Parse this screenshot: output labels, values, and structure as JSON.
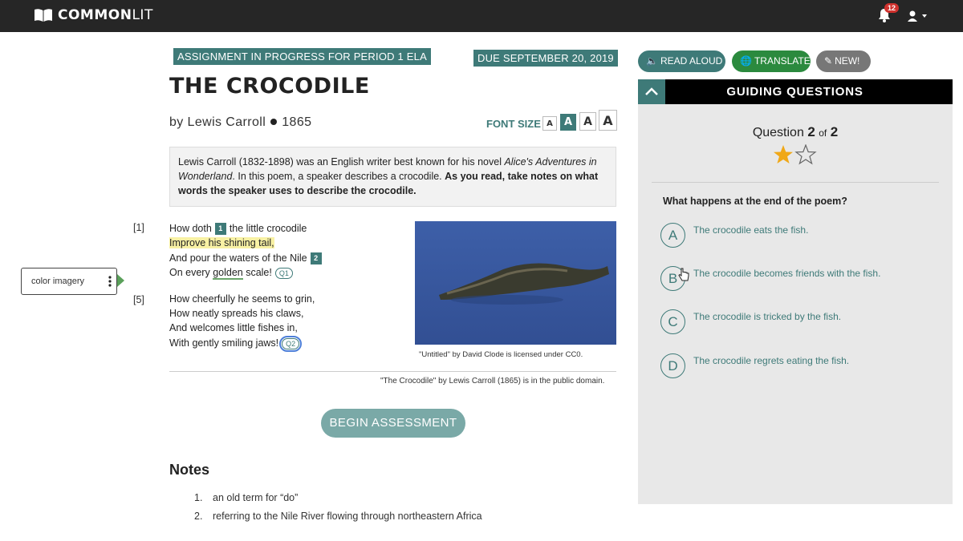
{
  "app": {
    "logo_text_bold": "COMMON",
    "logo_text_thin": "LIT",
    "notification_count": "12"
  },
  "assignment": {
    "tag": "ASSIGNMENT IN PROGRESS FOR PERIOD 1 ELA",
    "due": "DUE SEPTEMBER 20, 2019"
  },
  "text": {
    "title": "THE CROCODILE",
    "author": "by Lewis Carroll",
    "year": "1865",
    "font_size_label": "FONT SIZE",
    "font_size_buttons": [
      "A",
      "A",
      "A",
      "A"
    ],
    "intro_part1": "Lewis Carroll (1832-1898) was an English writer best known for his novel ",
    "intro_italic": "Alice's Adventures in Wonderland",
    "intro_part2": ". In this poem, a speaker describes a crocodile. ",
    "intro_bold": "As you read, take notes on what words the speaker uses to describe the crocodile."
  },
  "poem": {
    "line_numbers": [
      "[1]",
      "[5]"
    ],
    "l1_a": "How doth",
    "l1_fn": "1",
    "l1_b": "the little crocodile",
    "l2": "Improve his shining tail,",
    "l3_a": "And pour the waters of the Nile",
    "l3_fn": "2",
    "l4_a": "On every ",
    "l4_ul": "golden",
    "l4_b": " scale!",
    "l4_q": "Q1",
    "l5": "How cheerfully he seems to grin,",
    "l6": "How neatly spreads his claws,",
    "l7": "And welcomes little fishes in,",
    "l8": "With gently smiling jaws!",
    "l8_q": "Q2"
  },
  "annotation": {
    "label": "color imagery"
  },
  "image": {
    "caption": "\"Untitled\" by David Clode is licensed under CC0."
  },
  "public_domain": "\"The Crocodile\" by Lewis Carroll (1865) is in the public domain.",
  "begin_button": "BEGIN ASSESSMENT",
  "notes": {
    "title": "Notes",
    "items": [
      {
        "n": "1.",
        "text": "an old term for “do”"
      },
      {
        "n": "2.",
        "text": "referring to the Nile River flowing through northeastern Africa"
      }
    ]
  },
  "toolbar": {
    "read_aloud": "READ ALOUD",
    "translate": "TRANSLATE",
    "new": "NEW!"
  },
  "guiding": {
    "title": "GUIDING QUESTIONS",
    "question_word": "Question",
    "current": "2",
    "of": "of",
    "total": "2",
    "stars_filled": 1,
    "stars_total": 2,
    "question": "What happens at the end of the poem?",
    "choices": [
      {
        "letter": "A",
        "text": "The crocodile eats the fish."
      },
      {
        "letter": "B",
        "text": "The crocodile becomes friends with the fish."
      },
      {
        "letter": "C",
        "text": "The crocodile is tricked by the fish."
      },
      {
        "letter": "D",
        "text": "The crocodile regrets eating the fish."
      }
    ]
  },
  "colors": {
    "teal": "#3e7a78",
    "highlight": "#f8f1a4",
    "star": "#f0a818",
    "translate": "#2b8a3e"
  }
}
